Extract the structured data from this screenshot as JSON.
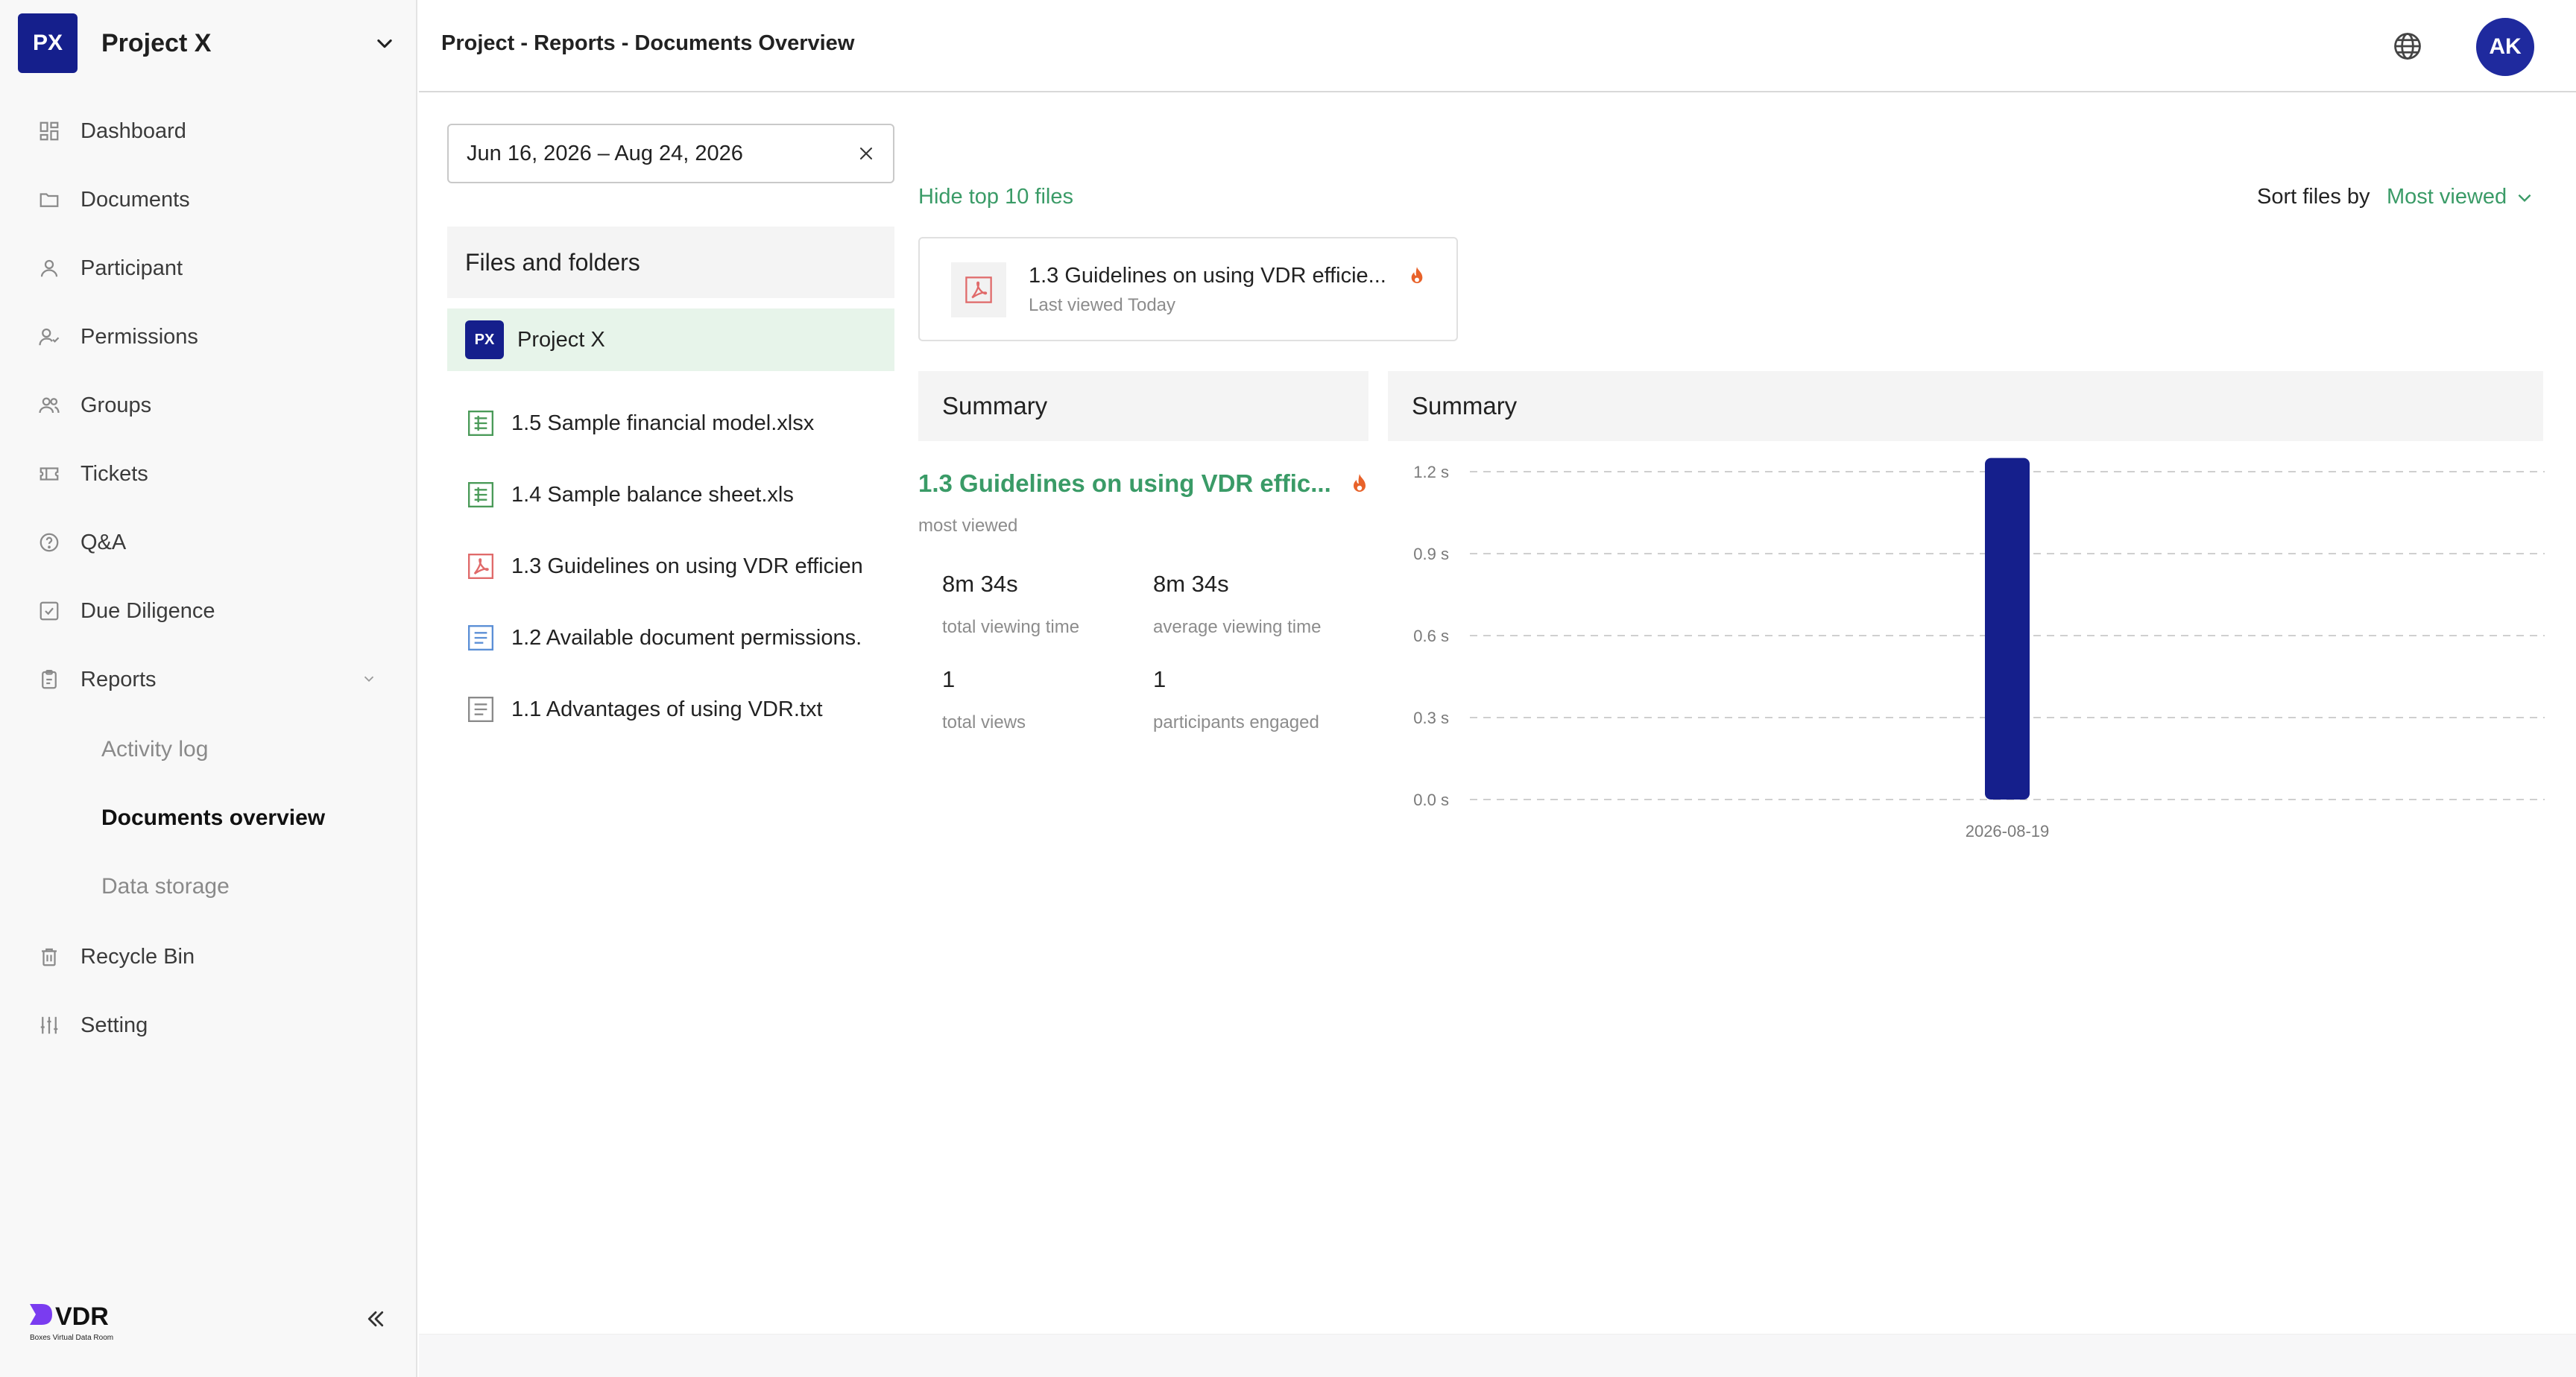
{
  "project": {
    "badge": "PX",
    "name": "Project X"
  },
  "nav": {
    "dashboard": "Dashboard",
    "documents": "Documents",
    "participant": "Participant",
    "permissions": "Permissions",
    "groups": "Groups",
    "tickets": "Tickets",
    "qa": "Q&A",
    "due_diligence": "Due Diligence",
    "reports": "Reports",
    "activity_log": "Activity log",
    "documents_overview": "Documents overview",
    "data_storage": "Data storage",
    "recycle_bin": "Recycle Bin",
    "setting": "Setting"
  },
  "brand": {
    "name": "VDR",
    "tagline": "Boxes Virtual Data Room"
  },
  "header": {
    "breadcrumb": "Project - Reports - Documents Overview",
    "avatar": "AK"
  },
  "filters": {
    "date_range": "Jun 16, 2026 – Aug 24, 2026"
  },
  "files": {
    "header": "Files and folders",
    "root": "Project X",
    "items": [
      {
        "name": "1.5 Sample financial model.xlsx",
        "type": "spreadsheet"
      },
      {
        "name": "1.4 Sample balance sheet.xls",
        "type": "spreadsheet"
      },
      {
        "name": "1.3 Guidelines on using VDR efficien",
        "type": "pdf"
      },
      {
        "name": "1.2 Available document permissions.",
        "type": "doc"
      },
      {
        "name": "1.1 Advantages of using VDR.txt",
        "type": "txt"
      }
    ]
  },
  "top_files": {
    "toggle": "Hide top 10 files",
    "sort_label": "Sort files by",
    "sort_value": "Most viewed",
    "items": [
      {
        "name": "1.3 Guidelines on using VDR efficie...",
        "sub": "Last viewed Today"
      }
    ]
  },
  "summary": {
    "left_title": "Summary",
    "right_title": "Summary",
    "most_viewed_name": "1.3 Guidelines on using VDR effic...",
    "most_viewed_label": "most viewed",
    "stats": [
      {
        "value": "8m 34s",
        "label": "total viewing time"
      },
      {
        "value": "8m 34s",
        "label": "average viewing time"
      },
      {
        "value": "1",
        "label": "total views"
      },
      {
        "value": "1",
        "label": "participants engaged"
      }
    ]
  },
  "colors": {
    "accent_green": "#3a9b67",
    "brand_navy": "#151f8c",
    "bar": "#151f8c"
  },
  "chart_data": {
    "type": "bar",
    "categories": [
      "2026-08-19"
    ],
    "series": [
      {
        "values": [
          1.25
        ]
      }
    ],
    "ytick_labels": [
      "0.0 s",
      "0.3 s",
      "0.6 s",
      "0.9 s",
      "1.2 s"
    ],
    "yticks": [
      0,
      0.3,
      0.6,
      0.9,
      1.2
    ],
    "ylim": [
      0,
      1.2
    ],
    "grid": true
  }
}
